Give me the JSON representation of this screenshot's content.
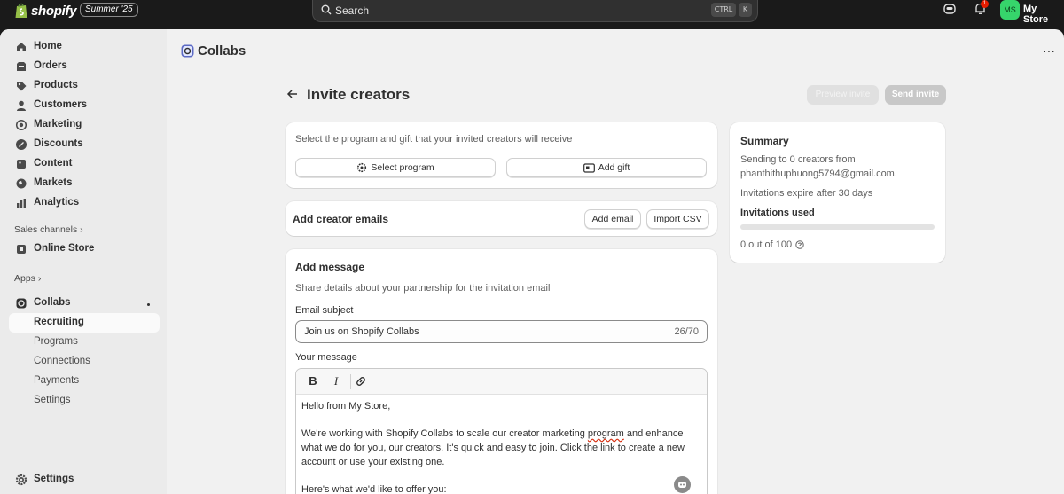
{
  "topbar": {
    "logo_text": "shopify",
    "badge": "Summer '25",
    "search_placeholder": "Search",
    "kbd_ctrl": "CTRL",
    "kbd_k": "K",
    "notification_count": "1",
    "avatar_initials": "MS",
    "store_name": "My Store"
  },
  "sidebar": {
    "items": [
      {
        "label": "Home",
        "icon": "home-icon"
      },
      {
        "label": "Orders",
        "icon": "orders-icon"
      },
      {
        "label": "Products",
        "icon": "tag-icon"
      },
      {
        "label": "Customers",
        "icon": "person-icon"
      },
      {
        "label": "Marketing",
        "icon": "target-icon"
      },
      {
        "label": "Discounts",
        "icon": "discount-icon"
      },
      {
        "label": "Content",
        "icon": "content-icon"
      },
      {
        "label": "Markets",
        "icon": "globe-icon"
      },
      {
        "label": "Analytics",
        "icon": "chart-icon"
      }
    ],
    "sales_channels_label": "Sales channels",
    "online_store_label": "Online Store",
    "apps_label": "Apps",
    "collabs_label": "Collabs",
    "collabs_sub": [
      "Recruiting",
      "Programs",
      "Connections",
      "Payments",
      "Settings"
    ],
    "settings_label": "Settings"
  },
  "page": {
    "app_title": "Collabs",
    "title": "Invite creators",
    "preview_button": "Preview invite",
    "send_button": "Send invite"
  },
  "program_card": {
    "description": "Select the program and gift that your invited creators will receive",
    "select_program": "Select program",
    "add_gift": "Add gift"
  },
  "emails_card": {
    "title": "Add creator emails",
    "add_email": "Add email",
    "import_csv": "Import CSV"
  },
  "message_card": {
    "title": "Add message",
    "description": "Share details about your partnership for the invitation email",
    "subject_label": "Email subject",
    "subject_value": "Join us on Shopify Collabs",
    "subject_count": "26/70",
    "message_label": "Your message",
    "toolbar": {
      "bold": "B",
      "italic": "I"
    },
    "body": {
      "greeting": "Hello from My Store,",
      "line1_a": "We're working with Shopify Collabs to scale our creator marketing ",
      "line1_b": "program",
      "line1_c": " and enhance",
      "line2": "what we do for you, our creators. It's quick and easy to join. Click the link to create a new",
      "line3": "account or use your existing one.",
      "line4": "Here's what we'd like to offer you:"
    }
  },
  "summary": {
    "title": "Summary",
    "sending_line1": "Sending to 0 creators from",
    "sending_line2": "phanthithuphuong5794@gmail.com.",
    "expire": "Invitations expire after 30 days",
    "used_label": "Invitations used",
    "used_fraction": 0,
    "used_text": "0 out of 100"
  },
  "colors": {
    "topbar": "#1a1a1a",
    "avatar": "#36d56b",
    "notification": "#e51c00"
  }
}
